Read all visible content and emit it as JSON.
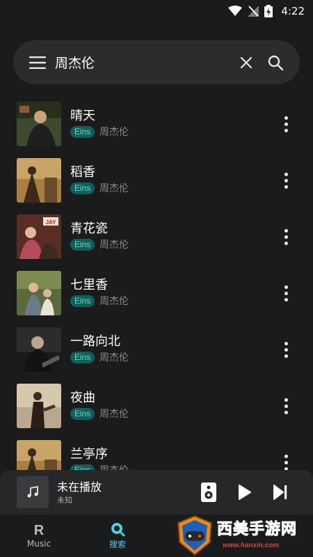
{
  "status_bar": {
    "time": "4:22"
  },
  "search": {
    "query": "周杰伦"
  },
  "songs": [
    {
      "title": "晴天",
      "badge": "Eins",
      "artist": "周杰伦",
      "cover_color": "#3d4a2c"
    },
    {
      "title": "稻香",
      "badge": "Eins",
      "artist": "周杰伦",
      "cover_color": "#a97e3f"
    },
    {
      "title": "青花瓷",
      "badge": "Eins",
      "artist": "周杰伦",
      "cover_color": "#8a3a2a"
    },
    {
      "title": "七里香",
      "badge": "Eins",
      "artist": "周杰伦",
      "cover_color": "#5b6a3a"
    },
    {
      "title": "一路向北",
      "badge": "Eins",
      "artist": "周杰伦",
      "cover_color": "#2c2c2c"
    },
    {
      "title": "夜曲",
      "badge": "Eins",
      "artist": "周杰伦",
      "cover_color": "#b9a88c"
    },
    {
      "title": "兰亭序",
      "badge": "Eins",
      "artist": "周杰伦",
      "cover_color": "#a97e3f"
    }
  ],
  "mini_player": {
    "title": "未在播放",
    "subtitle": "未知"
  },
  "bottom_nav": {
    "music": {
      "icon_letter": "R",
      "label": "Music"
    },
    "search": {
      "label": "搜索"
    }
  },
  "watermark": {
    "text": "西美手游网",
    "url": "www.hanxin.com"
  },
  "colors": {
    "accent": "#4dd0e1",
    "badge_bg": "#0f5f5b",
    "badge_text": "#6fd6ce",
    "background": "#1b1b1c"
  }
}
